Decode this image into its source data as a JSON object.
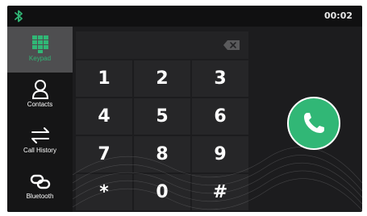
{
  "status": {
    "time": "00:02",
    "bluetooth_icon": "bluetooth-icon"
  },
  "sidebar": {
    "items": [
      {
        "label": "Keypad",
        "icon": "keypad-icon",
        "active": true
      },
      {
        "label": "Contacts",
        "icon": "contacts-icon",
        "active": false
      },
      {
        "label": "Call History",
        "icon": "call-history-icon",
        "active": false
      },
      {
        "label": "Bluetooth",
        "icon": "bluetooth-link-icon",
        "active": false
      }
    ]
  },
  "dialpad": {
    "input_value": "",
    "keys": [
      "1",
      "2",
      "3",
      "4",
      "5",
      "6",
      "7",
      "8",
      "9",
      "*",
      "0",
      "#"
    ]
  },
  "call_button": {
    "icon": "phone-icon"
  },
  "colors": {
    "accent": "#31b776",
    "background": "#1c1c1e",
    "key": "#262628",
    "active_item": "#4e4e50"
  }
}
